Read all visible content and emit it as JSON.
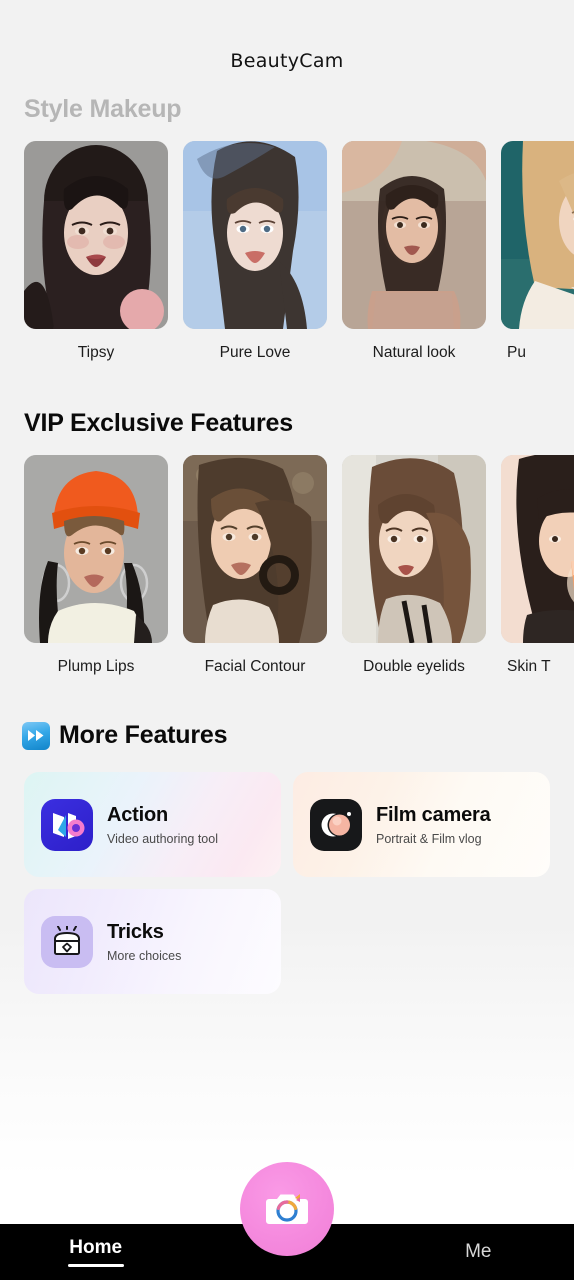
{
  "app": {
    "title": "BeautyCam"
  },
  "sections": [
    {
      "id": "style-makeup",
      "heading": "Style Makeup",
      "items": [
        {
          "label": "Tipsy"
        },
        {
          "label": "Pure Love"
        },
        {
          "label": "Natural look"
        },
        {
          "label": "Pu"
        }
      ]
    },
    {
      "id": "vip-exclusive",
      "heading": "VIP Exclusive Features",
      "items": [
        {
          "label": "Plump Lips"
        },
        {
          "label": "Facial Contour"
        },
        {
          "label": "Double eyelids"
        },
        {
          "label": "Skin T"
        }
      ]
    }
  ],
  "more_features": {
    "heading": "More Features",
    "heading_icon": "fast-forward-icon",
    "cards": [
      {
        "title": "Action",
        "subtitle": "Video authoring tool",
        "icon": "action-app-icon"
      },
      {
        "title": "Film camera",
        "subtitle": "Portrait & Film vlog",
        "icon": "film-camera-icon"
      },
      {
        "title": "Tricks",
        "subtitle": "More choices",
        "icon": "treasure-box-icon"
      }
    ]
  },
  "bottom_nav": {
    "items": [
      {
        "label": "Home",
        "active": true
      },
      {
        "label": "Me",
        "active": false
      }
    ],
    "camera_button_icon": "camera-icon"
  },
  "colors": {
    "background_top": "#f2f2f2",
    "background_bottom": "#ffffff",
    "nav_bar": "#000000",
    "camera_button": "#f58ade",
    "heading_muted": "#b6b6b6",
    "heading_dark": "#0a0a0a"
  }
}
